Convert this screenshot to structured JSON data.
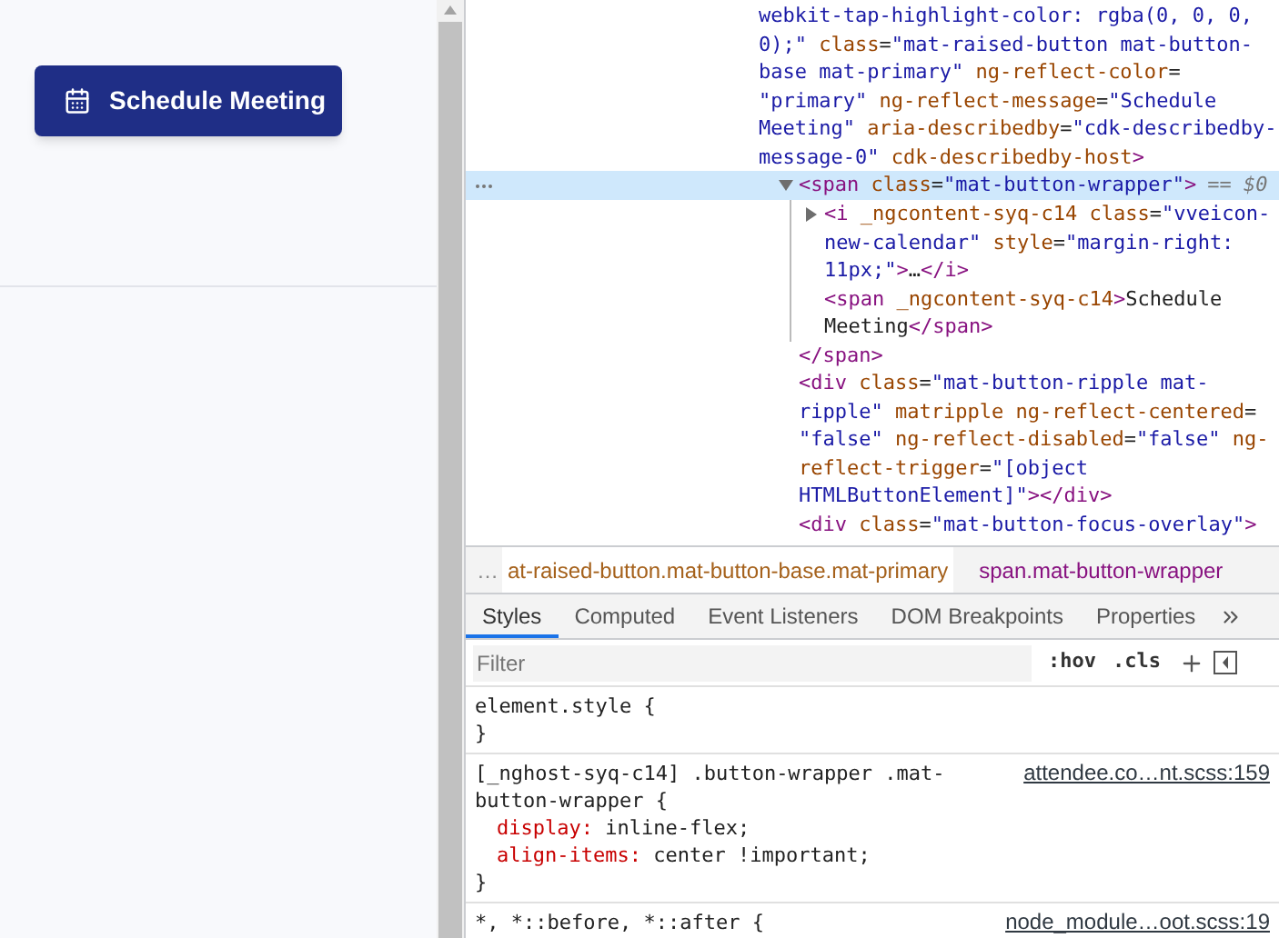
{
  "page": {
    "button": {
      "label": "Schedule Meeting"
    }
  },
  "devtools": {
    "dom_tree": {
      "nodes": [
        {
          "lines": [
            [
              {
                "kind": "value",
                "text": "webkit-tap-highlight-color: rgba(0, 0, 0,"
              }
            ],
            [
              {
                "kind": "value",
                "text": "0);\""
              },
              {
                "kind": "attr",
                "text": " class"
              },
              {
                "kind": "plain",
                "text": "="
              },
              {
                "kind": "value",
                "text": "\"mat-raised-button mat-button-"
              }
            ],
            [
              {
                "kind": "value",
                "text": "base mat-primary\""
              },
              {
                "kind": "attr",
                "text": " ng-reflect-color"
              },
              {
                "kind": "plain",
                "text": "="
              }
            ],
            [
              {
                "kind": "value",
                "text": "\"primary\""
              },
              {
                "kind": "attr",
                "text": " ng-reflect-message"
              },
              {
                "kind": "plain",
                "text": "="
              },
              {
                "kind": "value",
                "text": "\"Schedule"
              }
            ],
            [
              {
                "kind": "value",
                "text": "Meeting\""
              },
              {
                "kind": "attr",
                "text": " aria-describedby"
              },
              {
                "kind": "plain",
                "text": "="
              },
              {
                "kind": "value",
                "text": "\"cdk-describedby-"
              }
            ],
            [
              {
                "kind": "value",
                "text": "message-0\""
              },
              {
                "kind": "attr",
                "text": " cdk-describedby-host"
              },
              {
                "kind": "tag",
                "text": ">"
              }
            ]
          ],
          "children": [
            {
              "selected": true,
              "expanded": true,
              "marker": "== $0",
              "lines": [
                [
                  {
                    "kind": "tag",
                    "text": "<span"
                  },
                  {
                    "kind": "attr",
                    "text": " class"
                  },
                  {
                    "kind": "plain",
                    "text": "="
                  },
                  {
                    "kind": "value",
                    "text": "\"mat-button-wrapper\""
                  },
                  {
                    "kind": "tag",
                    "text": ">"
                  }
                ]
              ],
              "children": [
                {
                  "selected": false,
                  "expanded": false,
                  "lines": [
                    [
                      {
                        "kind": "tag",
                        "text": "<i"
                      },
                      {
                        "kind": "attr",
                        "text": " _ngcontent-syq-c14"
                      },
                      {
                        "kind": "attr",
                        "text": " class"
                      },
                      {
                        "kind": "plain",
                        "text": "="
                      },
                      {
                        "kind": "value",
                        "text": "\"vveicon-"
                      }
                    ],
                    [
                      {
                        "kind": "value",
                        "text": "new-calendar\""
                      },
                      {
                        "kind": "attr",
                        "text": " style"
                      },
                      {
                        "kind": "plain",
                        "text": "="
                      },
                      {
                        "kind": "value",
                        "text": "\"margin-right:"
                      }
                    ],
                    [
                      {
                        "kind": "value",
                        "text": "11px;\""
                      },
                      {
                        "kind": "tag",
                        "text": ">"
                      },
                      {
                        "kind": "plain",
                        "text": "…"
                      },
                      {
                        "kind": "tag",
                        "text": "</i>"
                      }
                    ]
                  ]
                },
                {
                  "selected": false,
                  "lines": [
                    [
                      {
                        "kind": "tag",
                        "text": "<span"
                      },
                      {
                        "kind": "attr",
                        "text": " _ngcontent-syq-c14"
                      },
                      {
                        "kind": "tag",
                        "text": ">"
                      },
                      {
                        "kind": "plain",
                        "text": "Schedule"
                      }
                    ],
                    [
                      {
                        "kind": "plain",
                        "text": "Meeting"
                      },
                      {
                        "kind": "tag",
                        "text": "</span>"
                      }
                    ]
                  ]
                }
              ],
              "closing": [
                {
                  "kind": "tag",
                  "text": "</span>"
                }
              ]
            },
            {
              "selected": false,
              "lines": [
                [
                  {
                    "kind": "tag",
                    "text": "<div"
                  },
                  {
                    "kind": "attr",
                    "text": " class"
                  },
                  {
                    "kind": "plain",
                    "text": "="
                  },
                  {
                    "kind": "value",
                    "text": "\"mat-button-ripple mat-"
                  }
                ],
                [
                  {
                    "kind": "value",
                    "text": "ripple\""
                  },
                  {
                    "kind": "attr",
                    "text": " matripple"
                  },
                  {
                    "kind": "attr",
                    "text": " ng-reflect-centered"
                  },
                  {
                    "kind": "plain",
                    "text": "="
                  }
                ],
                [
                  {
                    "kind": "value",
                    "text": "\"false\""
                  },
                  {
                    "kind": "attr",
                    "text": " ng-reflect-disabled"
                  },
                  {
                    "kind": "plain",
                    "text": "="
                  },
                  {
                    "kind": "value",
                    "text": "\"false\""
                  },
                  {
                    "kind": "attr",
                    "text": " ng-"
                  }
                ],
                [
                  {
                    "kind": "attr",
                    "text": "reflect-trigger"
                  },
                  {
                    "kind": "plain",
                    "text": "="
                  },
                  {
                    "kind": "value",
                    "text": "\"[object"
                  }
                ],
                [
                  {
                    "kind": "value",
                    "text": "HTMLButtonElement]\""
                  },
                  {
                    "kind": "tag",
                    "text": "></div>"
                  }
                ]
              ]
            },
            {
              "selected": false,
              "lines": [
                [
                  {
                    "kind": "tag",
                    "text": "<div"
                  },
                  {
                    "kind": "attr",
                    "text": " class"
                  },
                  {
                    "kind": "plain",
                    "text": "="
                  },
                  {
                    "kind": "value",
                    "text": "\"mat-button-focus-overlay\""
                  },
                  {
                    "kind": "tag",
                    "text": ">"
                  }
                ]
              ]
            }
          ]
        }
      ]
    },
    "breadcrumbs": [
      {
        "kind": "ellipsis",
        "label": "…",
        "hovered": false
      },
      {
        "kind": "crumb",
        "label": "at-raised-button.mat-button-base.mat-primary",
        "hovered": true
      },
      {
        "kind": "crumb",
        "label": "span.mat-button-wrapper",
        "hovered": false
      }
    ],
    "tabs": [
      {
        "label": "Styles",
        "selected": true
      },
      {
        "label": "Computed",
        "selected": false
      },
      {
        "label": "Event Listeners",
        "selected": false
      },
      {
        "label": "DOM Breakpoints",
        "selected": false
      },
      {
        "label": "Properties",
        "selected": false
      }
    ],
    "filter": {
      "placeholder": "Filter",
      "buttons": [
        ":hov",
        ".cls"
      ]
    },
    "rules": [
      {
        "selector_lines": [
          "element.style {"
        ],
        "closing": "}"
      },
      {
        "selector_lines": [
          "[_nghost-syq-c14] .button-wrapper .mat-",
          "button-wrapper {"
        ],
        "source": "attendee.co…nt.scss:159",
        "declarations": [
          {
            "property": "display:",
            "value": "inline-flex;"
          },
          {
            "property": "align-items:",
            "value": "center !important;"
          }
        ],
        "closing": "}"
      },
      {
        "selector_lines": [
          "*, *::before, *::after {"
        ],
        "source": "node_module…oot.scss:19"
      }
    ]
  }
}
